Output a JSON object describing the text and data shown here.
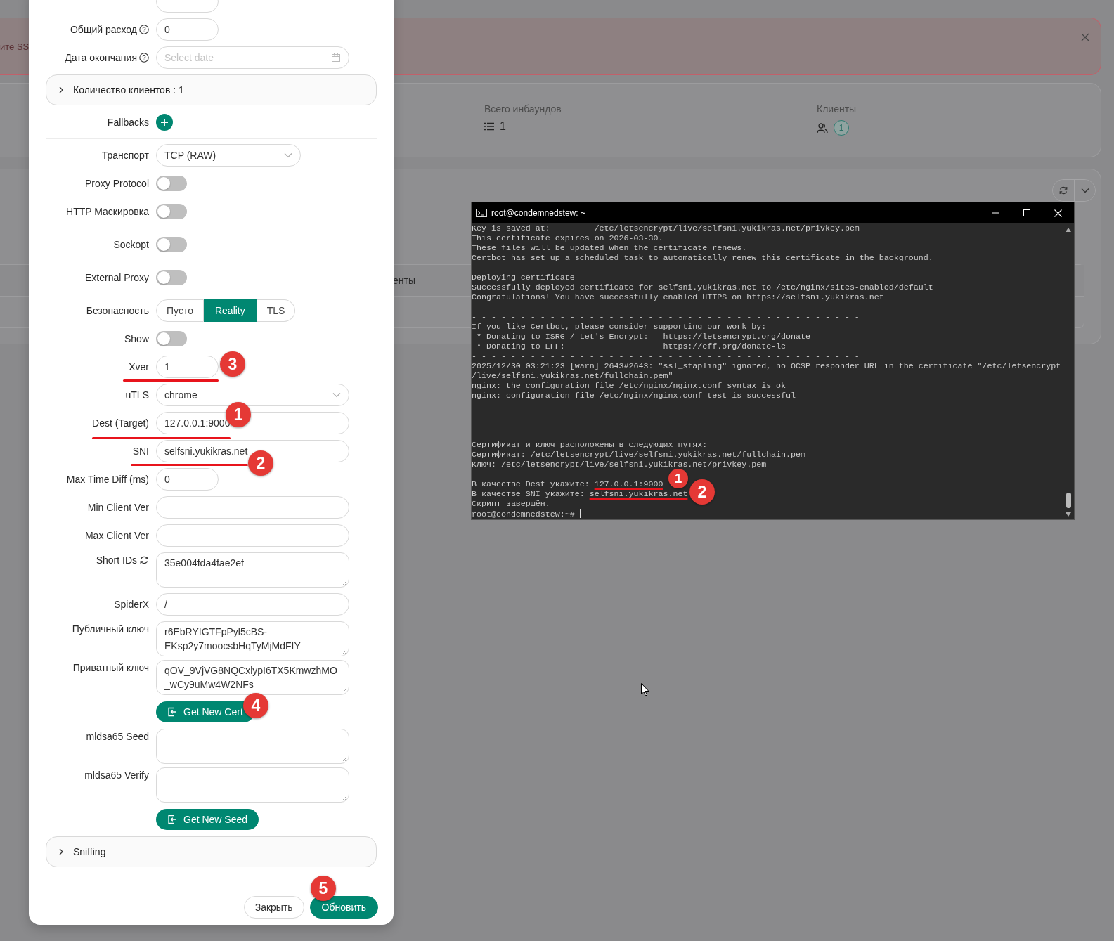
{
  "background_page": {
    "alert": {
      "text_fragment": "ите SS"
    },
    "stats": [
      {
        "label": "Всего инбаундов",
        "value": "1"
      },
      {
        "label": "Клиенты",
        "value": "1"
      }
    ],
    "table": {
      "header_fragment": "енты"
    }
  },
  "modal": {
    "rows": [
      {
        "kind": "number-input"
      },
      {
        "kind": "number-input",
        "label": "Общий расход",
        "help": true,
        "value": "0"
      },
      {
        "kind": "date-input",
        "label": "Дата окончания",
        "help": true,
        "placeholder": "Select date"
      },
      {
        "kind": "collapse",
        "title": "Количество клиентов : 1",
        "expanded": false
      },
      {
        "kind": "add-button",
        "label": "Fallbacks"
      },
      {
        "kind": "divider"
      },
      {
        "kind": "dropdown",
        "label": "Транспорт",
        "value": "TCP (RAW)"
      },
      {
        "kind": "switch",
        "label": "Proxy Protocol",
        "on": false
      },
      {
        "kind": "switch",
        "label": "HTTP Маскировка",
        "on": false
      },
      {
        "kind": "divider"
      },
      {
        "kind": "switch",
        "label": "Sockopt",
        "on": false
      },
      {
        "kind": "divider"
      },
      {
        "kind": "switch",
        "label": "External Proxy",
        "on": false
      },
      {
        "kind": "divider"
      },
      {
        "kind": "segmented",
        "label": "Безопасность",
        "options": [
          {
            "label": "Пусто",
            "selected": false
          },
          {
            "label": "Reality",
            "selected": true
          },
          {
            "label": "TLS",
            "selected": false
          }
        ]
      },
      {
        "kind": "switch",
        "label": "Show",
        "on": false
      },
      {
        "kind": "number-input",
        "label": "Xver",
        "value": "1"
      },
      {
        "kind": "wide-dropdown",
        "label": "uTLS",
        "value": "chrome"
      },
      {
        "kind": "text-input",
        "label": "Dest (Target)",
        "value": "127.0.0.1:9000"
      },
      {
        "kind": "text-input",
        "label": "SNI",
        "value": "selfsni.yukikras.net"
      },
      {
        "kind": "number-input",
        "label": "Max Time Diff (ms)",
        "value": "0"
      },
      {
        "kind": "text-input",
        "label": "Min Client Ver"
      },
      {
        "kind": "text-input",
        "label": "Max Client Ver"
      },
      {
        "kind": "textarea",
        "label": "Short IDs",
        "refresh": true,
        "value": "35e004fda4fae2ef"
      },
      {
        "kind": "text-input",
        "label": "SpiderX",
        "value": "/"
      },
      {
        "kind": "textarea",
        "label": "Публичный ключ",
        "value": "r6EbRYIGTFpPyl5cBS-EKsp2y7moocsbHqTyMjMdFIY"
      },
      {
        "kind": "textarea",
        "label": "Приватный ключ",
        "value": "qOV_9VjVG8NQCxlypI6TX5KmwzhMO_wCy9uMw4W2NFs"
      },
      {
        "kind": "action-button",
        "label": "Get New Cert"
      },
      {
        "kind": "textarea",
        "label": "mldsa65 Seed"
      },
      {
        "kind": "textarea",
        "label": "mldsa65 Verify"
      },
      {
        "kind": "action-button",
        "label": "Get New Seed"
      },
      {
        "kind": "collapse",
        "title": "Sniffing",
        "expanded": false
      }
    ],
    "footer_buttons": [
      {
        "label": "Закрыть",
        "kind": "default"
      },
      {
        "label": "Обновить",
        "kind": "primary"
      }
    ]
  },
  "terminal": {
    "title": "root@condemnedstew: ~",
    "top_blocks": [
      [
        "Key is saved at:         /etc/letsencrypt/live/selfsni.yukikras.net/privkey.pem",
        "This certificate expires on 2026-03-30.",
        "These files will be updated when the certificate renews.",
        "Certbot has set up a scheduled task to automatically renew this certificate in the background."
      ],
      [
        "Deploying certificate",
        "Successfully deployed certificate for selfsni.yukikras.net to /etc/nginx/sites-enabled/default",
        "Congratulations! You have successfully enabled HTTPS on https://selfsni.yukikras.net"
      ],
      [
        "- - - - - - - - - - - - - - - - - - - - - - - - - - - - - - - - - - - - - - - -",
        "If you like Certbot, please consider supporting our work by:",
        " * Donating to ISRG / Let's Encrypt:   https://letsencrypt.org/donate",
        " * Donating to EFF:                    https://eff.org/donate-le",
        "- - - - - - - - - - - - - - - - - - - - - - - - - - - - - - - - - - - - - - - -",
        "2025/12/30 03:21:23 [warn] 2643#2643: \"ssl_stapling\" ignored, no OCSP responder URL in the certificate \"/etc/letsencrypt",
        "/live/selfsni.yukikras.net/fullchain.pem\"",
        "nginx: the configuration file /etc/nginx/nginx.conf syntax is ok",
        "nginx: configuration file /etc/nginx/nginx.conf test is successful"
      ]
    ],
    "bottom_blocks": [
      [
        "Сертификат и ключ расположены в следующих путях:",
        "Сертификат: /etc/letsencrypt/live/selfsni.yukikras.net/fullchain.pem",
        "Ключ: /etc/letsencrypt/live/selfsni.yukikras.net/privkey.pem"
      ],
      [
        {
          "text": "В качестве Dest укажите: ",
          "underlined_part": "127.0.0.1:9000"
        },
        {
          "text": "В качестве SNI укажите: ",
          "underlined_part": "selfsni.yukikras.net"
        },
        "Скрипт завершён."
      ]
    ],
    "prompt": "root@condemnedstew:~#"
  },
  "annotations": [
    {
      "number": "3"
    },
    {
      "number": "1"
    },
    {
      "number": "2"
    },
    {
      "number": "4"
    },
    {
      "number": "5"
    },
    {
      "number": "1"
    },
    {
      "number": "2"
    }
  ]
}
